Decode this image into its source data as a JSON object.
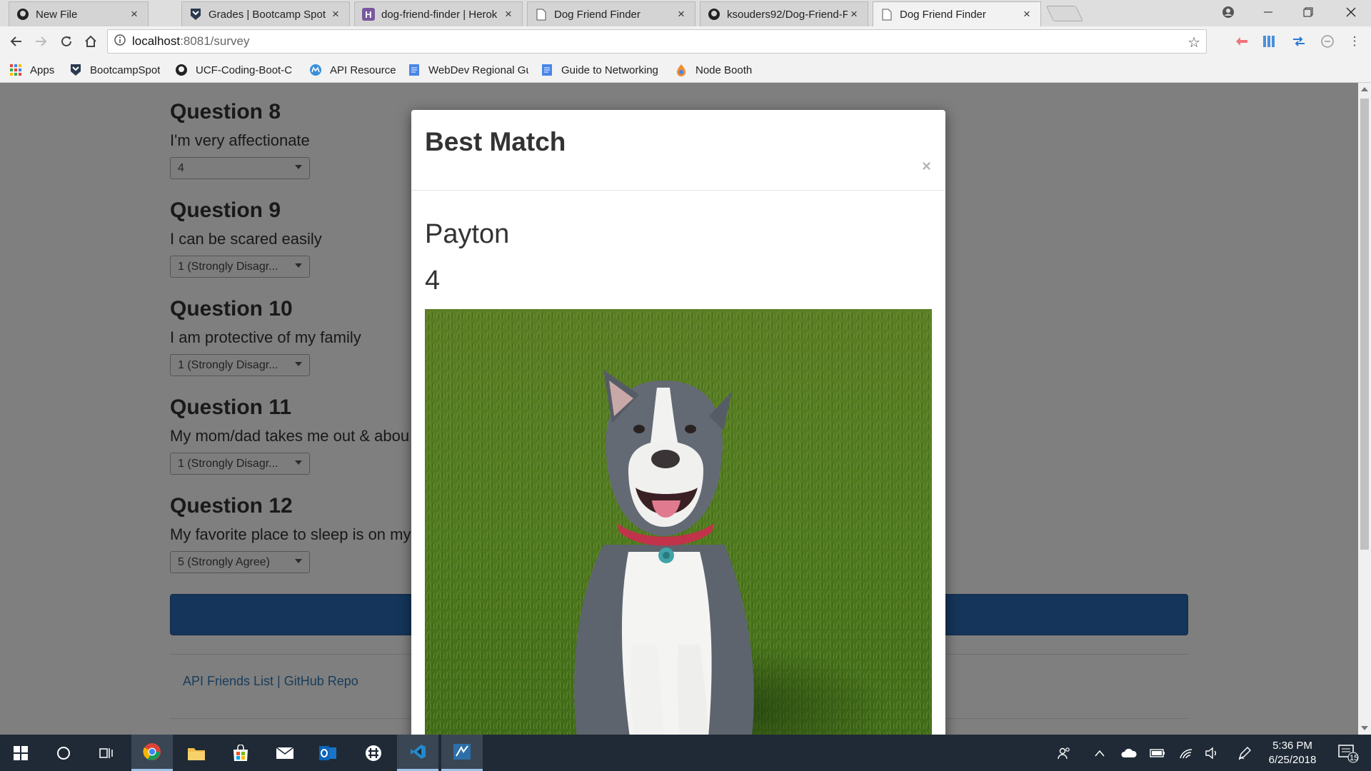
{
  "browser": {
    "tabs": [
      {
        "title": "New File",
        "icon": "github-icon"
      },
      {
        "title": "Grades | Bootcamp Spot",
        "icon": "bootcampspot-icon"
      },
      {
        "title": "dog-friend-finder | Herok",
        "icon": "heroku-icon"
      },
      {
        "title": "Dog Friend Finder",
        "icon": "page-icon"
      },
      {
        "title": "ksouders92/Dog-Friend-F",
        "icon": "github-icon"
      },
      {
        "title": "Dog Friend Finder",
        "icon": "page-icon",
        "active": true
      }
    ],
    "close_glyph": "×",
    "url_host": "localhost",
    "url_path": ":8081/survey",
    "bookmarks": [
      {
        "label": "Apps",
        "icon": "apps-grid-icon"
      },
      {
        "label": "BootcampSpot",
        "icon": "bootcampspot-icon"
      },
      {
        "label": "UCF-Coding-Boot-C",
        "icon": "github-icon"
      },
      {
        "label": "API Resource",
        "icon": "api-icon"
      },
      {
        "label": "WebDev Regional Gu",
        "icon": "doc-icon"
      },
      {
        "label": "Guide to Networking",
        "icon": "doc-icon"
      },
      {
        "label": "Node Booth",
        "icon": "node-booth-icon"
      }
    ]
  },
  "survey": {
    "questions": [
      {
        "title": "Question 8",
        "text": "I'm very affectionate",
        "value": "4"
      },
      {
        "title": "Question 9",
        "text": "I can be scared easily",
        "value": "1 (Strongly Disagr..."
      },
      {
        "title": "Question 10",
        "text": "I am protective of my family",
        "value": "1 (Strongly Disagr..."
      },
      {
        "title": "Question 11",
        "text": "My mom/dad takes me out & abou",
        "value": "1 (Strongly Disagr..."
      },
      {
        "title": "Question 12",
        "text": "My favorite place to sleep is on my",
        "value": "5 (Strongly Agree)"
      }
    ],
    "footer": {
      "link1": "API Friends List",
      "separator": " | ",
      "link2": "GitHub Repo"
    }
  },
  "modal": {
    "title": "Best Match",
    "close": "×",
    "match_name": "Payton",
    "match_score": "4",
    "photo_subject": "grey-and-white-pitbull-dog-on-grass"
  },
  "taskbar": {
    "time": "5:36 PM",
    "date": "6/25/2018",
    "notification_count": "15"
  },
  "colors": {
    "submit_button": "#2a6bb5",
    "link": "#337ab7",
    "taskbar": "#1f2a36"
  }
}
